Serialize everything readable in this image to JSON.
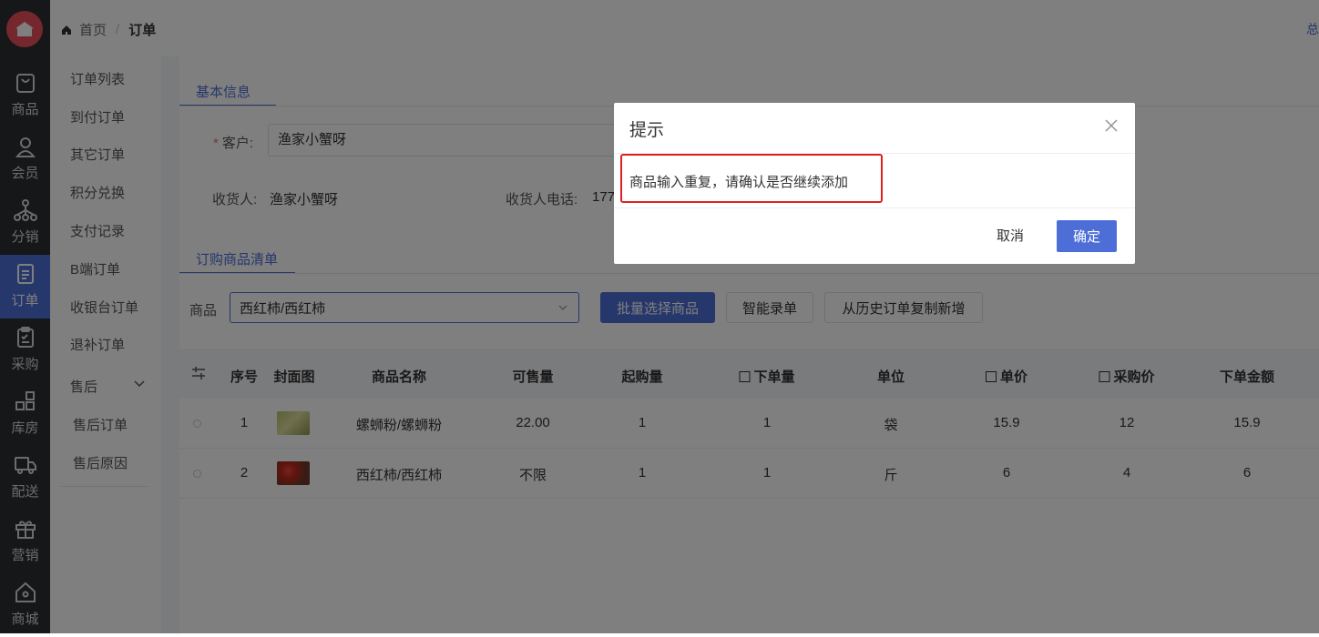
{
  "breadcrumb": {
    "home": "首页",
    "current": "订单",
    "right_text": "总"
  },
  "rail": {
    "items": [
      {
        "label": "商品",
        "icon": "bag-icon"
      },
      {
        "label": "会员",
        "icon": "person-icon"
      },
      {
        "label": "分销",
        "icon": "network-icon"
      },
      {
        "label": "订单",
        "icon": "document-icon",
        "active": true
      },
      {
        "label": "采购",
        "icon": "clipboard-icon"
      },
      {
        "label": "库房",
        "icon": "grid-icon"
      },
      {
        "label": "配送",
        "icon": "truck-icon"
      },
      {
        "label": "营销",
        "icon": "gift-icon"
      },
      {
        "label": "商城",
        "icon": "home-icon"
      }
    ]
  },
  "submenu": {
    "items": [
      "订单列表",
      "到付订单",
      "其它订单",
      "积分兑换",
      "支付记录",
      "B端订单",
      "收银台订单",
      "退补订单"
    ],
    "after_sales": "售后",
    "after_sales_children": [
      "售后订单",
      "售后原因"
    ]
  },
  "basic_info": {
    "tab": "基本信息",
    "customer_label": "客户:",
    "customer_value": "渔家小蟹呀",
    "receiver_label": "收货人:",
    "receiver_value": "渔家小蟹呀",
    "phone_label": "收货人电话:",
    "phone_value": "177"
  },
  "goods_list": {
    "tab": "订购商品清单",
    "product_label": "商品",
    "product_value": "西红柿/西红柿",
    "buttons": {
      "batch_select": "批量选择商品",
      "smart_entry": "智能录单",
      "copy_history": "从历史订单复制新增"
    }
  },
  "table": {
    "columns": [
      "序号",
      "封面图",
      "商品名称",
      "可售量",
      "起购量",
      "下单量",
      "单位",
      "单价",
      "采购价",
      "下单金额"
    ],
    "rows": [
      {
        "index": "1",
        "name": "螺蛳粉/螺蛳粉",
        "stock": "22.00",
        "min_buy": "1",
        "qty": "1",
        "unit": "袋",
        "price": "15.9",
        "purchase_price": "12",
        "amount": "15.9"
      },
      {
        "index": "2",
        "name": "西红柿/西红柿",
        "stock": "不限",
        "min_buy": "1",
        "qty": "1",
        "unit": "斤",
        "price": "6",
        "purchase_price": "4",
        "amount": "6"
      }
    ]
  },
  "dialog": {
    "title": "提示",
    "message": "商品输入重复，请确认是否继续添加",
    "cancel": "取消",
    "confirm": "确定"
  },
  "colors": {
    "accent": "#4d6ed6",
    "rail_bg": "#2d2f33",
    "highlight": "#e02020",
    "required": "#f56c6c"
  }
}
